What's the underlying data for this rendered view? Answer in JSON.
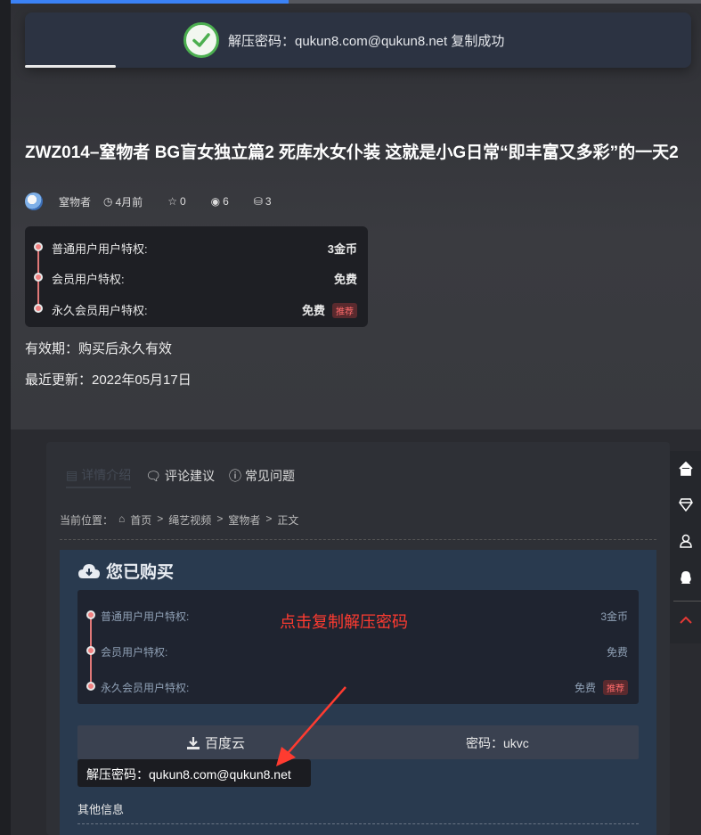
{
  "toast": {
    "message": "解压密码：qukun8.com@qukun8.net 复制成功"
  },
  "post": {
    "title": "ZWZ014–窒物者 BG盲女独立篇2 死库水女仆装 这就是小G日常“即丰富又多彩”的一天2",
    "author": "窒物者",
    "time": "4月前",
    "stars": "0",
    "views": "6",
    "coins": "3"
  },
  "pricing": {
    "rows": [
      {
        "label": "普通用户用户特权:",
        "value": "3金币"
      },
      {
        "label": "会员用户特权:",
        "value": "免费"
      },
      {
        "label": "永久会员用户特权:",
        "value": "免费",
        "badge": "推荐"
      }
    ]
  },
  "validity": "有效期：购买后永久有效",
  "updated": "最近更新：2022年05月17日",
  "tabs": [
    {
      "label": "详情介绍",
      "active": true
    },
    {
      "label": "评论建议"
    },
    {
      "label": "常见问题"
    }
  ],
  "breadcrumb": {
    "prefix": "当前位置：",
    "items": [
      "首页",
      ">",
      "绳艺视频",
      ">",
      "窒物者",
      ">",
      "正文"
    ]
  },
  "purchased": {
    "title": "您已购买",
    "annotation": "点击复制解压密码",
    "rows": [
      {
        "label": "普通用户用户特权:",
        "value": "3金币"
      },
      {
        "label": "会员用户特权:",
        "value": "免费"
      },
      {
        "label": "永久会员用户特权:",
        "value": "免费",
        "badge": "推荐"
      }
    ],
    "download_label": "百度云",
    "password_label": "密码：ukvc",
    "unzip_password": "解压密码：qukun8.com@qukun8.net",
    "other_info": "其他信息"
  },
  "colors": {
    "accent": "#3b82f6",
    "success": "#4caf50",
    "annotation": "#ff3b30",
    "dot": "#f08080"
  }
}
